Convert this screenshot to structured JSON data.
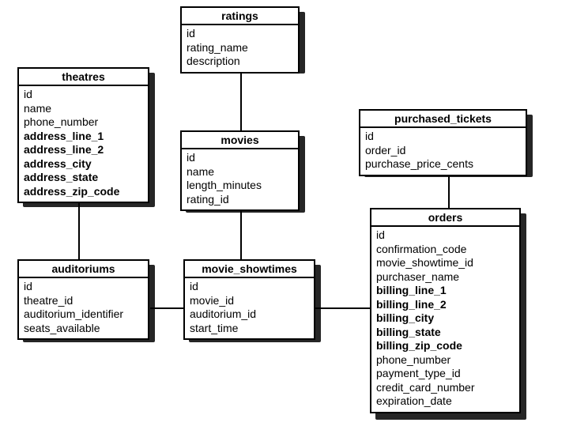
{
  "entities": {
    "theatres": {
      "title": "theatres",
      "fields": [
        "id",
        "name",
        "phone_number",
        "address_line_1",
        "address_line_2",
        "address_city",
        "address_state",
        "address_zip_code"
      ],
      "bold": [
        "address_line_1",
        "address_line_2",
        "address_city",
        "address_state",
        "address_zip_code"
      ]
    },
    "ratings": {
      "title": "ratings",
      "fields": [
        "id",
        "rating_name",
        "description"
      ],
      "bold": []
    },
    "purchased_tickets": {
      "title": "purchased_tickets",
      "fields": [
        "id",
        "order_id",
        "purchase_price_cents"
      ],
      "bold": []
    },
    "movies": {
      "title": "movies",
      "fields": [
        "id",
        "name",
        "length_minutes",
        "rating_id"
      ],
      "bold": []
    },
    "orders": {
      "title": "orders",
      "fields": [
        "id",
        "confirmation_code",
        "movie_showtime_id",
        "purchaser_name",
        "billing_line_1",
        "billing_line_2",
        "billing_city",
        "billing_state",
        "billing_zip_code",
        "phone_number",
        "payment_type_id",
        "credit_card_number",
        "expiration_date"
      ],
      "bold": [
        "billing_line_1",
        "billing_line_2",
        "billing_city",
        "billing_state",
        "billing_zip_code"
      ]
    },
    "auditoriums": {
      "title": "auditoriums",
      "fields": [
        "id",
        "theatre_id",
        "auditorium_identifier",
        "seats_available"
      ],
      "bold": []
    },
    "movie_showtimes": {
      "title": "movie_showtimes",
      "fields": [
        "id",
        "movie_id",
        "auditorium_id",
        "start_time"
      ],
      "bold": []
    }
  },
  "relationships": [
    [
      "ratings",
      "movies"
    ],
    [
      "movies",
      "movie_showtimes"
    ],
    [
      "theatres",
      "auditoriums"
    ],
    [
      "auditoriums",
      "movie_showtimes"
    ],
    [
      "movie_showtimes",
      "orders"
    ],
    [
      "purchased_tickets",
      "orders"
    ]
  ]
}
